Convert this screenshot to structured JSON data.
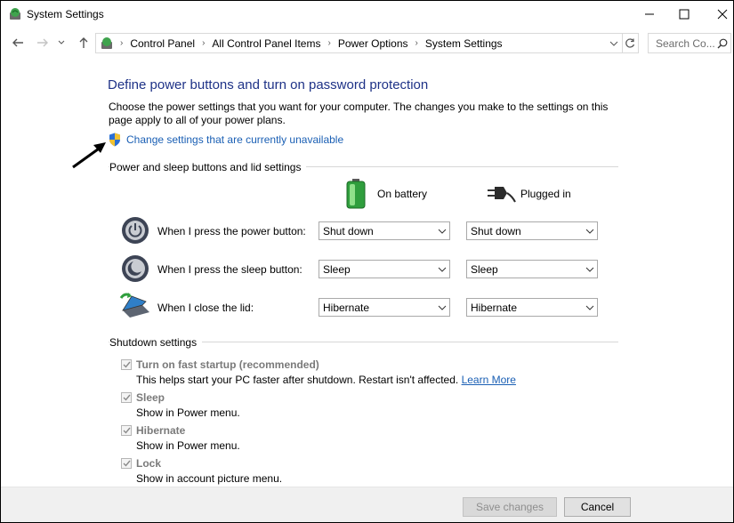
{
  "window": {
    "title": "System Settings"
  },
  "nav": {
    "breadcrumbs": [
      "Control Panel",
      "All Control Panel Items",
      "Power Options",
      "System Settings"
    ],
    "search_placeholder": "Search Co..."
  },
  "main": {
    "heading": "Define power buttons and turn on password protection",
    "description": "Choose the power settings that you want for your computer. The changes you make to the settings on this page apply to all of your power plans.",
    "change_link": "Change settings that are currently unavailable"
  },
  "power_section": {
    "title": "Power and sleep buttons and lid settings",
    "col_battery": "On battery",
    "col_plugged": "Plugged in",
    "rows": [
      {
        "label": "When I press the power button:",
        "battery": "Shut down",
        "plugged": "Shut down"
      },
      {
        "label": "When I press the sleep button:",
        "battery": "Sleep",
        "plugged": "Sleep"
      },
      {
        "label": "When I close the lid:",
        "battery": "Hibernate",
        "plugged": "Hibernate"
      }
    ]
  },
  "shutdown_section": {
    "title": "Shutdown settings",
    "items": [
      {
        "label": "Turn on fast startup (recommended)",
        "desc": "This helps start your PC faster after shutdown. Restart isn't affected.",
        "link": "Learn More",
        "checked": true
      },
      {
        "label": "Sleep",
        "desc": "Show in Power menu.",
        "checked": true
      },
      {
        "label": "Hibernate",
        "desc": "Show in Power menu.",
        "checked": true
      },
      {
        "label": "Lock",
        "desc": "Show in account picture menu.",
        "checked": true
      }
    ]
  },
  "footer": {
    "save": "Save changes",
    "cancel": "Cancel"
  },
  "colors": {
    "heading": "#1e3287",
    "link": "#1a5fb4",
    "disabled_text": "#7a7a7a",
    "footer_bg": "#f0f0f0"
  }
}
